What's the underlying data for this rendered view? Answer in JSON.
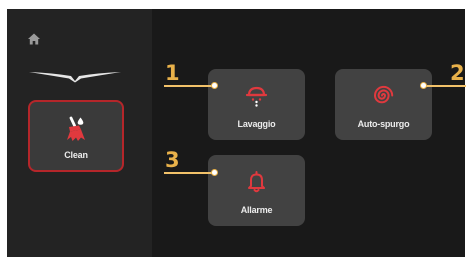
{
  "sidebar": {
    "home_icon": "home-icon",
    "logo_icon": "bird-logo-icon",
    "clean": {
      "label": "Clean",
      "icon": "cleaning-brush-icon",
      "selected": true
    }
  },
  "tiles": [
    {
      "label": "Lavaggio",
      "icon": "washing-shower-icon"
    },
    {
      "label": "Auto-spurgo",
      "icon": "spiral-purge-icon"
    },
    {
      "label": "Allarme",
      "icon": "bell-icon"
    }
  ],
  "callouts": [
    "1",
    "2",
    "3"
  ],
  "colors": {
    "accent": "#b5262a",
    "icon_red": "#e0393e",
    "callout": "#e8b14a",
    "screen_bg": "#191919",
    "sidebar_bg": "#232323",
    "tile_bg": "#424242"
  }
}
